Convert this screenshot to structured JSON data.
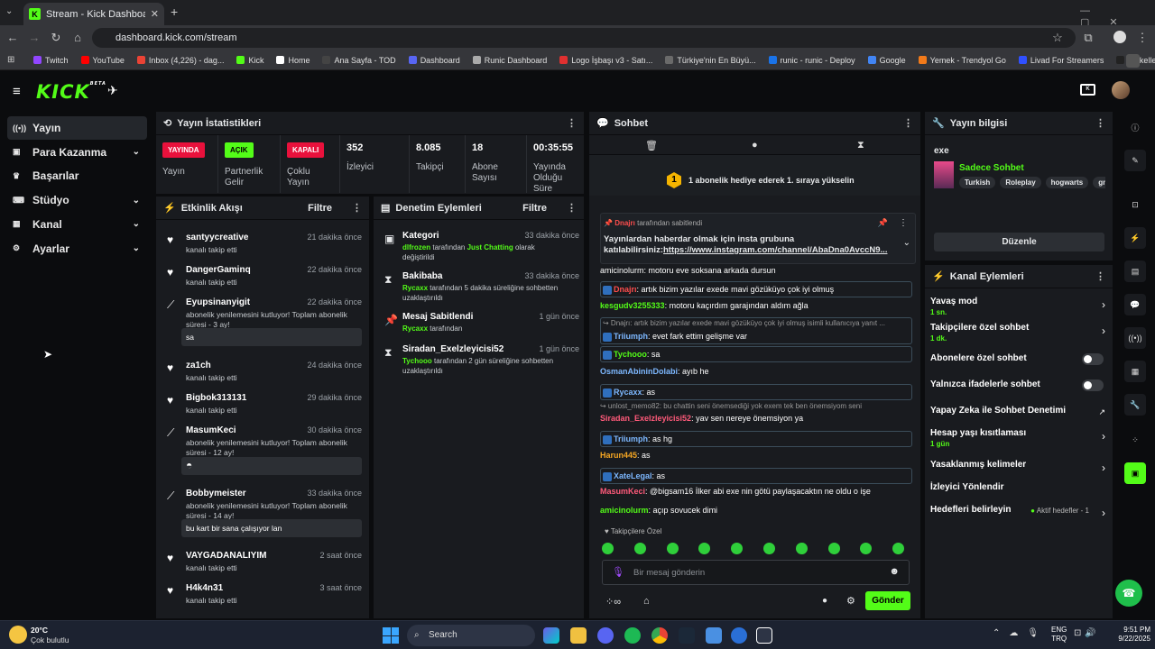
{
  "browser": {
    "tab_title": "Stream - Kick Dashboard",
    "url": "dashboard.kick.com/stream",
    "bookmarks": [
      {
        "label": "Twitch",
        "color": "#9146ff"
      },
      {
        "label": "YouTube",
        "color": "#ff0000"
      },
      {
        "label": "Inbox (4,226) - dag...",
        "color": "#ea4335"
      },
      {
        "label": "Kick",
        "color": "#53fc18"
      },
      {
        "label": "Home",
        "color": "#ffffff"
      },
      {
        "label": "Ana Sayfa - TOD",
        "color": "#444444"
      },
      {
        "label": "Dashboard",
        "color": "#5865f2"
      },
      {
        "label": "Runic Dashboard",
        "color": "#aaaaaa"
      },
      {
        "label": "Logo İşbaşı v3 - Satı...",
        "color": "#e03030"
      },
      {
        "label": "Türkiye'nin En Büyü...",
        "color": "#6a6a6a"
      },
      {
        "label": "runic - runic - Deploy",
        "color": "#1a73e8"
      },
      {
        "label": "Google",
        "color": "#4285f4"
      },
      {
        "label": "Yemek - Trendyol Go",
        "color": "#f27a1a"
      },
      {
        "label": "Livad For Streamers",
        "color": "#3050ff"
      },
      {
        "label": "Mükellef | Anasayfa...",
        "color": "#222222"
      }
    ]
  },
  "kick": {
    "logo": "KICK",
    "beta": "BETA"
  },
  "nav": [
    {
      "label": "Yayın",
      "icon": "broadcast-icon",
      "chevron": false
    },
    {
      "label": "Para Kazanma",
      "icon": "money-icon",
      "chevron": true
    },
    {
      "label": "Başarılar",
      "icon": "trophy-icon",
      "chevron": false
    },
    {
      "label": "Stüdyo",
      "icon": "studio-icon",
      "chevron": true
    },
    {
      "label": "Kanal",
      "icon": "channel-icon",
      "chevron": true
    },
    {
      "label": "Ayarlar",
      "icon": "settings-icon",
      "chevron": true
    }
  ],
  "stats": {
    "title": "Yayın İstatistikleri",
    "badges": [
      {
        "badge": "YAYINDA",
        "label": "Yayın",
        "color": "#e9113c"
      },
      {
        "badge": "AÇIK",
        "label": "Partnerlik Gelir",
        "color": "#53fc18"
      },
      {
        "badge": "KAPALI",
        "label": "Çoklu Yayın",
        "color": "#e9113c"
      }
    ],
    "values": [
      {
        "value": "352",
        "label": "İzleyici"
      },
      {
        "value": "8.085",
        "label": "Takipçi"
      },
      {
        "value": "18",
        "label": "Abone Sayısı"
      },
      {
        "value": "00:35:55",
        "label": "Yayında Olduğu Süre"
      }
    ]
  },
  "activity": {
    "title": "Etkinlik Akışı",
    "filter": "Filtre",
    "items": [
      {
        "name": "santyycreative",
        "time": "21 dakika önce",
        "desc": "kanalı takip etti",
        "msg": ""
      },
      {
        "name": "DangerGaminq",
        "time": "22 dakika önce",
        "desc": "kanalı takip etti",
        "msg": ""
      },
      {
        "name": "Eyupsinanyigit",
        "time": "22 dakika önce",
        "desc": "abonelik yenilemesini kutluyor! Toplam abonelik süresi - 3 ay!",
        "msg": "sa"
      },
      {
        "name": "za1ch",
        "time": "24 dakika önce",
        "desc": "kanalı takip etti",
        "msg": ""
      },
      {
        "name": "Bigbok313131",
        "time": "29 dakika önce",
        "desc": "kanalı takip etti",
        "msg": ""
      },
      {
        "name": "MasumKeci",
        "time": "30 dakika önce",
        "desc": "abonelik yenilemesini kutluyor! Toplam abonelik süresi - 12 ay!",
        "msg": ""
      },
      {
        "name": "Bobbymeister",
        "time": "33 dakika önce",
        "desc": "abonelik yenilemesini kutluyor! Toplam abonelik süresi - 14 ay!",
        "msg": "bu kart bir sana çalışıyor lan"
      },
      {
        "name": "VAYGADANALIYIM",
        "time": "2 saat önce",
        "desc": "kanalı takip etti",
        "msg": ""
      },
      {
        "name": "H4k4n31",
        "time": "3 saat önce",
        "desc": "kanalı takip etti",
        "msg": ""
      }
    ]
  },
  "moderation": {
    "title": "Denetim Eylemleri",
    "filter": "Filtre",
    "items": [
      {
        "title": "Kategori",
        "time": "33 dakika önce",
        "user": "dlfrozen",
        "desc": "tarafından",
        "extra": "Just Chatting",
        "desc2": "olarak değiştirildi"
      },
      {
        "title": "Bakibaba",
        "time": "33 dakika önce",
        "user": "Rycaxx",
        "desc": "tarafından 5 dakika süreliğine sohbetten uzaklaştırıldı",
        "extra": "",
        "desc2": ""
      },
      {
        "title": "Mesaj Sabitlendi",
        "time": "1 gün önce",
        "user": "Rycaxx",
        "desc": "tarafından",
        "extra": "",
        "desc2": ""
      },
      {
        "title": "Siradan_Exelzleyicisi52",
        "time": "1 gün önce",
        "user": "Tychooo",
        "desc": "tarafından 2 gün süreliğine sohbetten uzaklaştırıldı",
        "extra": "",
        "desc2": ""
      }
    ]
  },
  "chat": {
    "title": "Sohbet",
    "gift_text": "1 abonelik hediye ederek 1. sıraya yükselin",
    "gift_rank": "1",
    "pinned": {
      "by": "Dnajrı",
      "label": "tarafından sabitlendi",
      "text": "Yayınlardan haberdar olmak için insta grubuna katılabilirsiniz:",
      "link": "https://www.instagram.com/channel/AbaDna0AvccN9..."
    },
    "partial_top": "amicinolurm: motoru eve soksana arkada dursun",
    "messages": [
      {
        "user": "Dnajrı",
        "color": "#ff4d4d",
        "text": "artık bizim yazılar exede mavi gözüküyo çok iyi olmuş",
        "boxed": true
      },
      {
        "user": "kesgudv3255333",
        "color": "#53fc18",
        "text": "motoru kaçırdım garajından aldım ağla",
        "boxed": false
      },
      {
        "user": "Triiumph",
        "color": "#7db8ff",
        "text": "evet fark ettim gelişme var",
        "boxed": true,
        "reply": "↪ Dnajrı: artık bizim yazılar exede mavi gözüküyo çok iyi olmuş isimli kullanıcıya yanıt ..."
      },
      {
        "user": "Tychooo",
        "color": "#53fc18",
        "text": "sa",
        "boxed": true
      },
      {
        "user": "OsmanAbininDolabi",
        "color": "#7db8ff",
        "text": "ayıb he",
        "boxed": false
      },
      {
        "user": "Rycaxx",
        "color": "#7db8ff",
        "text": "as",
        "boxed": true
      },
      {
        "user": "Siradan_Exelzleyicisi52",
        "color": "#ff5a7a",
        "text": "yav sen nereye önemsiyon ya",
        "boxed": false,
        "reply": "↪ unlost_memo82: bu chattin seni önemsediği yok exem tek ben önemsiyom seni"
      },
      {
        "user": "Triiumph",
        "color": "#7db8ff",
        "text": "as hg",
        "boxed": true
      },
      {
        "user": "Harun445",
        "color": "#f5a623",
        "text": "as",
        "boxed": false
      },
      {
        "user": "XateLegal",
        "color": "#7db8ff",
        "text": "as",
        "boxed": true
      },
      {
        "user": "MasumKeci",
        "color": "#ff5a7a",
        "text": "@bigsam16 İlker abi exe nin götü paylaşacaktın ne oldu o işe",
        "boxed": false
      },
      {
        "user": "amicinolurm",
        "color": "#53fc18",
        "text": "açıp sovucek dimi",
        "boxed": false
      }
    ],
    "emote_label": "Takipçilere Özel",
    "placeholder": "Bir mesaj gönderin",
    "send": "Gönder"
  },
  "info": {
    "title": "Yayın bilgisi",
    "stream_title": "exe",
    "category": "Sadece Sohbet",
    "tags": [
      "Turkish",
      "Roleplay",
      "hogwarts",
      "gm"
    ],
    "edit": "Düzenle"
  },
  "channel_actions": {
    "title": "Kanal Eylemleri",
    "items": [
      {
        "label": "Yavaş mod",
        "sub": "1 sn.",
        "type": "arrow"
      },
      {
        "label": "Takipçilere özel sohbet",
        "sub": "1 dk.",
        "type": "arrow"
      },
      {
        "label": "Abonelere özel sohbet",
        "sub": "",
        "type": "toggle"
      },
      {
        "label": "Yalnızca ifadelerle sohbet",
        "sub": "",
        "type": "toggle"
      },
      {
        "label": "Yapay Zeka ile Sohbet Denetimi",
        "sub": "",
        "type": "ext"
      },
      {
        "label": "Hesap yaşı kısıtlaması",
        "sub": "1 gün",
        "type": "arrow"
      },
      {
        "label": "Yasaklanmış kelimeler",
        "sub": "",
        "type": "arrow"
      },
      {
        "label": "İzleyici Yönlendir",
        "sub": "",
        "type": "none"
      },
      {
        "label": "Hedefleri belirleyin",
        "sub": "",
        "type": "arrow",
        "status": "Aktif hedefler - 1"
      }
    ]
  },
  "taskbar": {
    "weather_temp": "20°C",
    "weather_desc": "Çok bulutlu",
    "search": "Search",
    "lang": "ENG",
    "lang2": "TRQ",
    "time": "9:51 PM",
    "date": "9/22/2025"
  }
}
